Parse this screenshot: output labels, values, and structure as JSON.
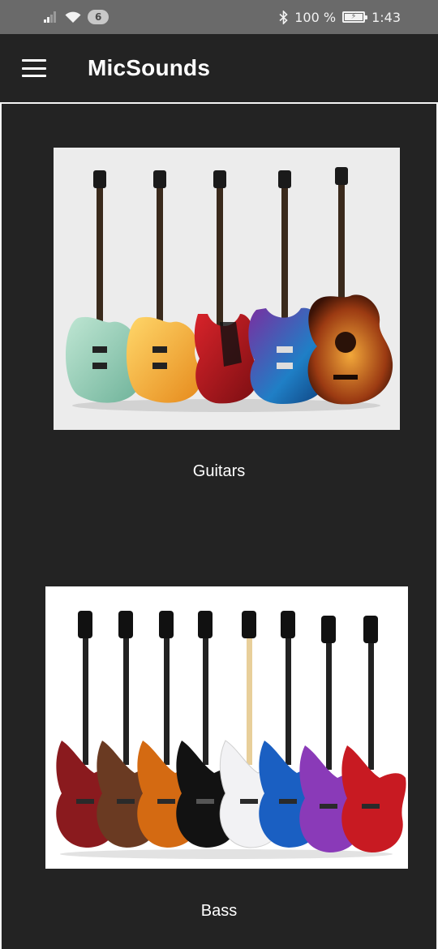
{
  "status_bar": {
    "notification_count": "6",
    "battery_percent": "100 %",
    "time": "1:43"
  },
  "app_bar": {
    "title": "MicSounds",
    "menu_icon": "hamburger-menu-icon"
  },
  "categories": [
    {
      "label": "Guitars",
      "image": "guitars-photo"
    },
    {
      "label": "Bass",
      "image": "bass-photo"
    }
  ],
  "colors": {
    "background": "#232323",
    "status_bar": "#6a6a6a",
    "text": "#ffffff"
  }
}
